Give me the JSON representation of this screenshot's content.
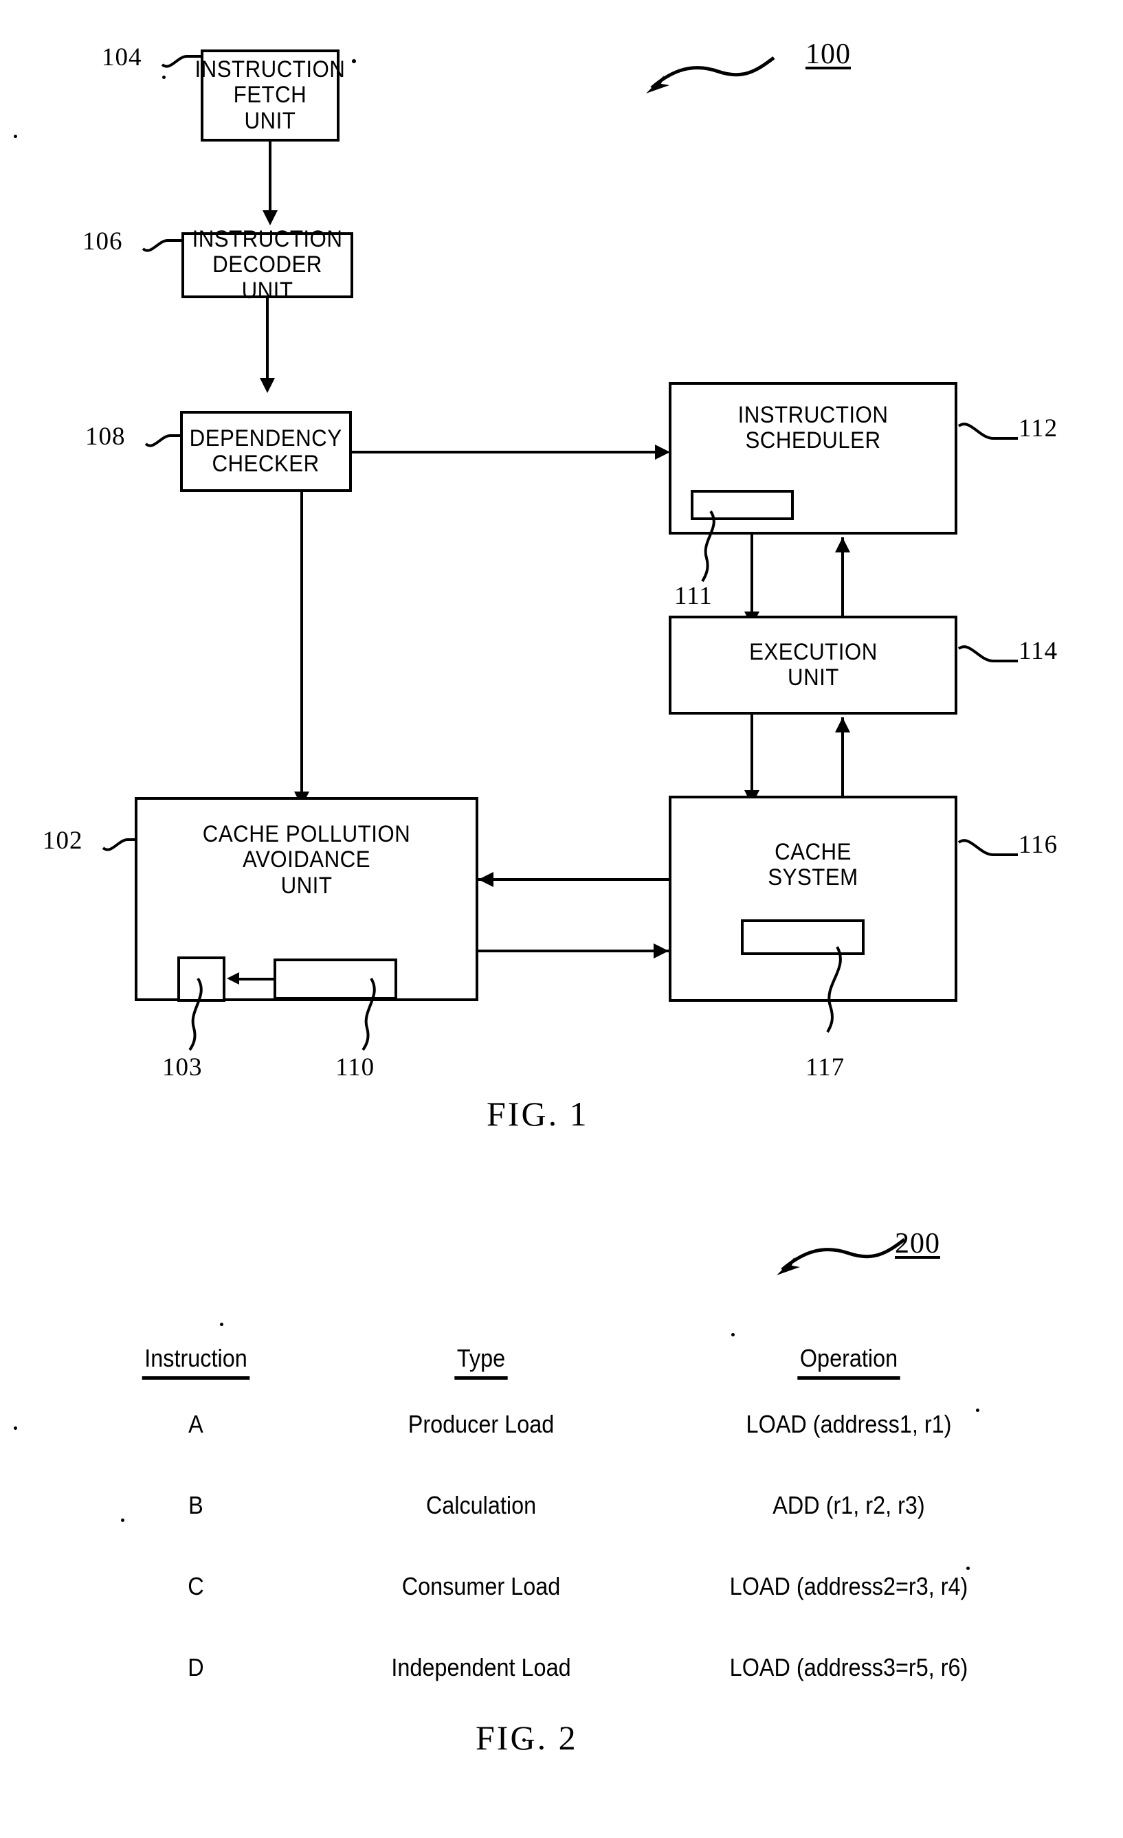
{
  "figure1": {
    "figure_number": "100",
    "caption": "FIG.  1",
    "blocks": [
      {
        "id": "instruction-fetch-unit",
        "ref": "104",
        "label": "INSTRUCTION\nFETCH\nUNIT"
      },
      {
        "id": "instruction-decoder-unit",
        "ref": "106",
        "label": "INSTRUCTION\nDECODER UNIT"
      },
      {
        "id": "dependency-checker",
        "ref": "108",
        "label": "DEPENDENCY\nCHECKER"
      },
      {
        "id": "instruction-scheduler",
        "ref": "112",
        "label": "INSTRUCTION\nSCHEDULER"
      },
      {
        "id": "execution-unit",
        "ref": "114",
        "label": "EXECUTION\nUNIT"
      },
      {
        "id": "cache-pollution-avoidance-unit",
        "ref": "102",
        "label": "CACHE POLLUTION\nAVOIDANCE\nUNIT"
      },
      {
        "id": "cache-system",
        "ref": "116",
        "label": "CACHE\nSYSTEM"
      }
    ],
    "inner_blocks": [
      {
        "id": "scheduler-inner",
        "ref": "111",
        "label": ""
      },
      {
        "id": "cpau-inner-small",
        "ref": "103",
        "label": ""
      },
      {
        "id": "cpau-inner-wide",
        "ref": "110",
        "label": ""
      },
      {
        "id": "cache-inner",
        "ref": "117",
        "label": ""
      }
    ]
  },
  "figure2": {
    "figure_number": "200",
    "caption": "FIG.  2",
    "table": {
      "headers": [
        "Instruction",
        "Type",
        "Operation"
      ],
      "rows": [
        [
          "A",
          "Producer Load",
          "LOAD (address1, r1)"
        ],
        [
          "B",
          "Calculation",
          "ADD (r1, r2, r3)"
        ],
        [
          "C",
          "Consumer Load",
          "LOAD (address2=r3, r4)"
        ],
        [
          "D",
          "Independent Load",
          "LOAD (address3=r5, r6)"
        ]
      ]
    }
  }
}
